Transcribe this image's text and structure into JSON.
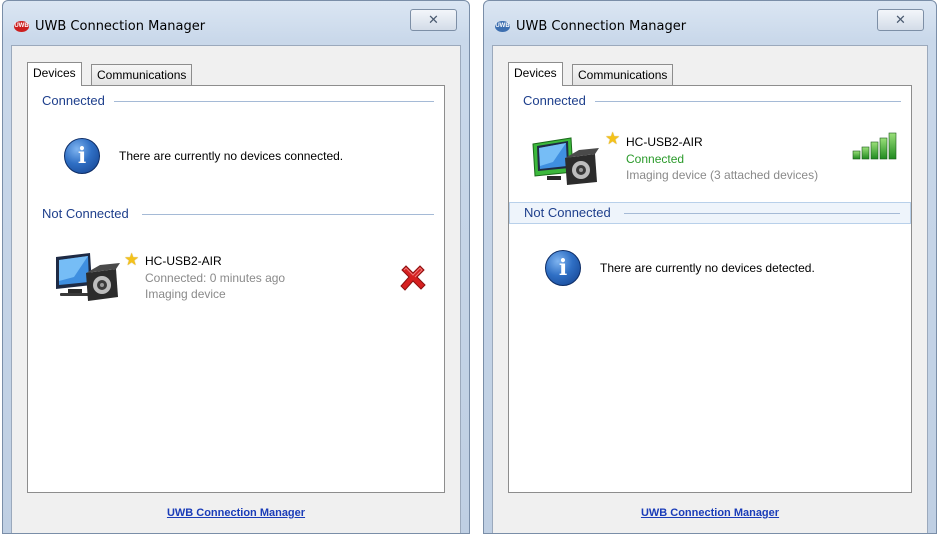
{
  "windows": [
    {
      "title": "UWB Connection Manager",
      "app_icon_label": "UWB",
      "close_label": "✕",
      "tabs": [
        {
          "label": "Devices",
          "active": true
        },
        {
          "label": "Communications",
          "active": false
        }
      ],
      "connected": {
        "header": "Connected",
        "message": "There are currently no devices connected."
      },
      "not_connected": {
        "header": "Not Connected",
        "device": {
          "name": "HC-USB2-AIR",
          "status": "Connected: 0 minutes ago",
          "type": "Imaging device"
        }
      },
      "footer_link": "UWB Connection Manager"
    },
    {
      "title": "UWB Connection Manager",
      "app_icon_label": "UWB",
      "close_label": "✕",
      "tabs": [
        {
          "label": "Devices",
          "active": true
        },
        {
          "label": "Communications",
          "active": false
        }
      ],
      "connected": {
        "header": "Connected",
        "device": {
          "name": "HC-USB2-AIR",
          "status": "Connected",
          "type": "Imaging device (3 attached devices)",
          "signal_level": 1.0
        }
      },
      "not_connected": {
        "header": "Not Connected",
        "message": "There are currently no devices detected."
      },
      "footer_link": "UWB Connection Manager"
    }
  ],
  "colors": {
    "group_header": "#1e3f8c",
    "status_green": "#2a9a2a",
    "link": "#1a3cb8",
    "remove_red": "#d62020"
  },
  "icons": {
    "info": "i",
    "star": "★"
  }
}
